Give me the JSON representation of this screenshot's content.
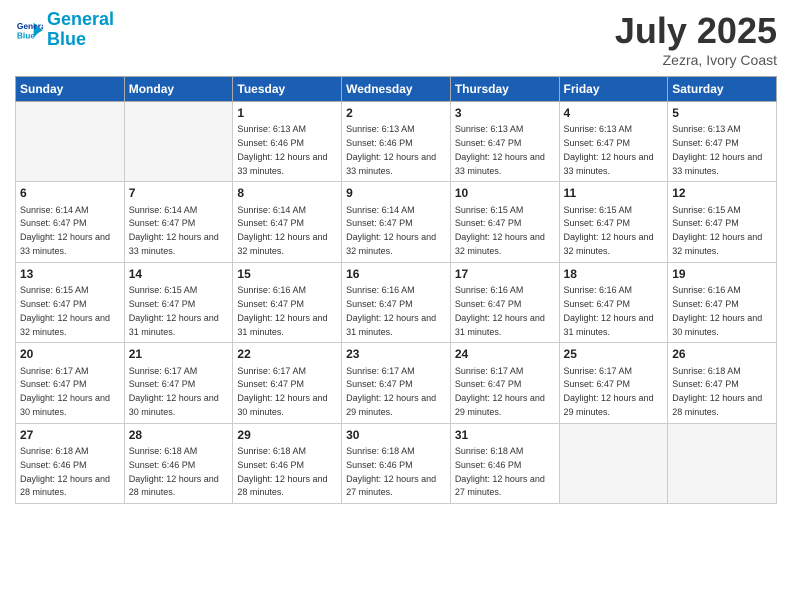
{
  "logo": {
    "line1": "General",
    "line2": "Blue"
  },
  "title": "July 2025",
  "location": "Zezra, Ivory Coast",
  "days_of_week": [
    "Sunday",
    "Monday",
    "Tuesday",
    "Wednesday",
    "Thursday",
    "Friday",
    "Saturday"
  ],
  "weeks": [
    [
      {
        "num": "",
        "empty": true
      },
      {
        "num": "",
        "empty": true
      },
      {
        "num": "1",
        "sunrise": "6:13 AM",
        "sunset": "6:46 PM",
        "daylight": "12 hours and 33 minutes."
      },
      {
        "num": "2",
        "sunrise": "6:13 AM",
        "sunset": "6:46 PM",
        "daylight": "12 hours and 33 minutes."
      },
      {
        "num": "3",
        "sunrise": "6:13 AM",
        "sunset": "6:47 PM",
        "daylight": "12 hours and 33 minutes."
      },
      {
        "num": "4",
        "sunrise": "6:13 AM",
        "sunset": "6:47 PM",
        "daylight": "12 hours and 33 minutes."
      },
      {
        "num": "5",
        "sunrise": "6:13 AM",
        "sunset": "6:47 PM",
        "daylight": "12 hours and 33 minutes."
      }
    ],
    [
      {
        "num": "6",
        "sunrise": "6:14 AM",
        "sunset": "6:47 PM",
        "daylight": "12 hours and 33 minutes."
      },
      {
        "num": "7",
        "sunrise": "6:14 AM",
        "sunset": "6:47 PM",
        "daylight": "12 hours and 33 minutes."
      },
      {
        "num": "8",
        "sunrise": "6:14 AM",
        "sunset": "6:47 PM",
        "daylight": "12 hours and 32 minutes."
      },
      {
        "num": "9",
        "sunrise": "6:14 AM",
        "sunset": "6:47 PM",
        "daylight": "12 hours and 32 minutes."
      },
      {
        "num": "10",
        "sunrise": "6:15 AM",
        "sunset": "6:47 PM",
        "daylight": "12 hours and 32 minutes."
      },
      {
        "num": "11",
        "sunrise": "6:15 AM",
        "sunset": "6:47 PM",
        "daylight": "12 hours and 32 minutes."
      },
      {
        "num": "12",
        "sunrise": "6:15 AM",
        "sunset": "6:47 PM",
        "daylight": "12 hours and 32 minutes."
      }
    ],
    [
      {
        "num": "13",
        "sunrise": "6:15 AM",
        "sunset": "6:47 PM",
        "daylight": "12 hours and 32 minutes."
      },
      {
        "num": "14",
        "sunrise": "6:15 AM",
        "sunset": "6:47 PM",
        "daylight": "12 hours and 31 minutes."
      },
      {
        "num": "15",
        "sunrise": "6:16 AM",
        "sunset": "6:47 PM",
        "daylight": "12 hours and 31 minutes."
      },
      {
        "num": "16",
        "sunrise": "6:16 AM",
        "sunset": "6:47 PM",
        "daylight": "12 hours and 31 minutes."
      },
      {
        "num": "17",
        "sunrise": "6:16 AM",
        "sunset": "6:47 PM",
        "daylight": "12 hours and 31 minutes."
      },
      {
        "num": "18",
        "sunrise": "6:16 AM",
        "sunset": "6:47 PM",
        "daylight": "12 hours and 31 minutes."
      },
      {
        "num": "19",
        "sunrise": "6:16 AM",
        "sunset": "6:47 PM",
        "daylight": "12 hours and 30 minutes."
      }
    ],
    [
      {
        "num": "20",
        "sunrise": "6:17 AM",
        "sunset": "6:47 PM",
        "daylight": "12 hours and 30 minutes."
      },
      {
        "num": "21",
        "sunrise": "6:17 AM",
        "sunset": "6:47 PM",
        "daylight": "12 hours and 30 minutes."
      },
      {
        "num": "22",
        "sunrise": "6:17 AM",
        "sunset": "6:47 PM",
        "daylight": "12 hours and 30 minutes."
      },
      {
        "num": "23",
        "sunrise": "6:17 AM",
        "sunset": "6:47 PM",
        "daylight": "12 hours and 29 minutes."
      },
      {
        "num": "24",
        "sunrise": "6:17 AM",
        "sunset": "6:47 PM",
        "daylight": "12 hours and 29 minutes."
      },
      {
        "num": "25",
        "sunrise": "6:17 AM",
        "sunset": "6:47 PM",
        "daylight": "12 hours and 29 minutes."
      },
      {
        "num": "26",
        "sunrise": "6:18 AM",
        "sunset": "6:47 PM",
        "daylight": "12 hours and 28 minutes."
      }
    ],
    [
      {
        "num": "27",
        "sunrise": "6:18 AM",
        "sunset": "6:46 PM",
        "daylight": "12 hours and 28 minutes."
      },
      {
        "num": "28",
        "sunrise": "6:18 AM",
        "sunset": "6:46 PM",
        "daylight": "12 hours and 28 minutes."
      },
      {
        "num": "29",
        "sunrise": "6:18 AM",
        "sunset": "6:46 PM",
        "daylight": "12 hours and 28 minutes."
      },
      {
        "num": "30",
        "sunrise": "6:18 AM",
        "sunset": "6:46 PM",
        "daylight": "12 hours and 27 minutes."
      },
      {
        "num": "31",
        "sunrise": "6:18 AM",
        "sunset": "6:46 PM",
        "daylight": "12 hours and 27 minutes."
      },
      {
        "num": "",
        "empty": true
      },
      {
        "num": "",
        "empty": true
      }
    ]
  ]
}
